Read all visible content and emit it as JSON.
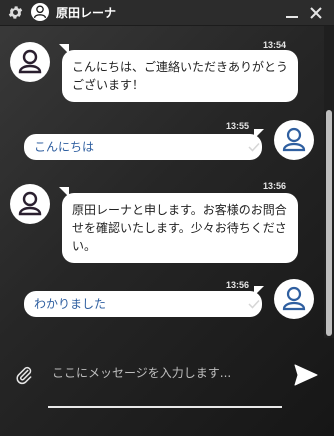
{
  "header": {
    "agent_name": "原田レーナ"
  },
  "messages": [
    {
      "direction": "in",
      "time": "13:54",
      "text": "こんにちは、ご連絡いただきありがとうございます！"
    },
    {
      "direction": "out",
      "time": "13:55",
      "text": "こんにちは"
    },
    {
      "direction": "in",
      "time": "13:56",
      "text": "原田レーナと申します。お客様のお問合せを確認いたします。少々お待ちください。"
    },
    {
      "direction": "out",
      "time": "13:56",
      "text": "わかりました"
    }
  ],
  "composer": {
    "placeholder": "ここにメッセージを入力します..."
  },
  "colors": {
    "user_text": "#2f5fa0",
    "background": "#262626"
  }
}
